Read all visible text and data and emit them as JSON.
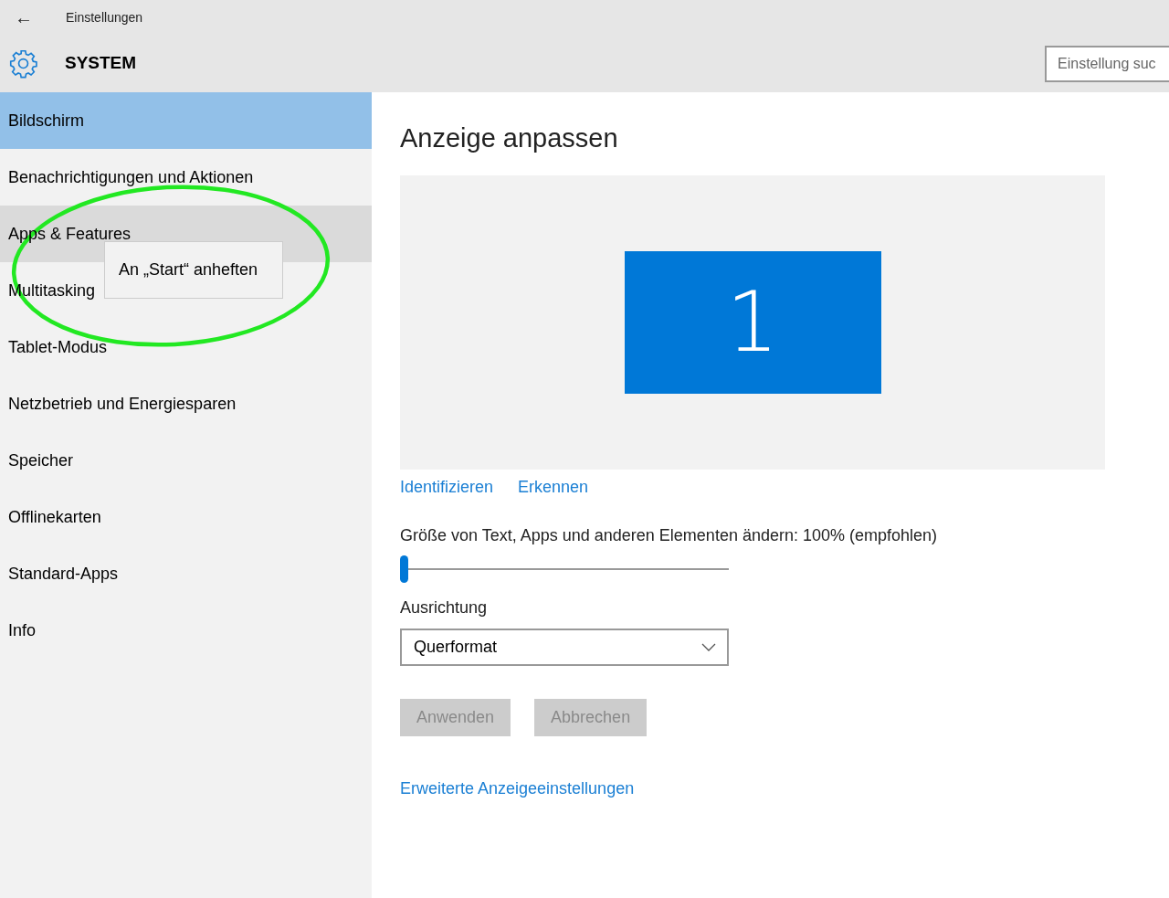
{
  "header": {
    "back_label": "←",
    "app_title": "Einstellungen",
    "section_title": "SYSTEM",
    "search": {
      "placeholder": "Einstellung suc"
    }
  },
  "sidebar": {
    "items": [
      {
        "label": "Bildschirm",
        "selected": true,
        "hovered": false
      },
      {
        "label": "Benachrichtigungen und Aktionen",
        "selected": false,
        "hovered": false
      },
      {
        "label": "Apps & Features",
        "selected": false,
        "hovered": true
      },
      {
        "label": "Multitasking",
        "selected": false,
        "hovered": false
      },
      {
        "label": "Tablet-Modus",
        "selected": false,
        "hovered": false
      },
      {
        "label": "Netzbetrieb und Energiesparen",
        "selected": false,
        "hovered": false
      },
      {
        "label": "Speicher",
        "selected": false,
        "hovered": false
      },
      {
        "label": "Offlinekarten",
        "selected": false,
        "hovered": false
      },
      {
        "label": "Standard-Apps",
        "selected": false,
        "hovered": false
      },
      {
        "label": "Info",
        "selected": false,
        "hovered": false
      }
    ]
  },
  "context_menu": {
    "items": [
      "An „Start“ anheften"
    ]
  },
  "main": {
    "title": "Anzeige anpassen",
    "display_preview": {
      "monitor_number": "1"
    },
    "links": [
      "Identifizieren",
      "Erkennen"
    ],
    "scale": {
      "label": "Größe von Text, Apps und anderen Elementen ändern: 100% (empfohlen)",
      "level": 0
    },
    "orientation": {
      "label": "Ausrichtung",
      "value": "Querformat"
    },
    "buttons": [
      {
        "label": "Anwenden",
        "disabled": true
      },
      {
        "label": "Abbrechen",
        "disabled": true
      }
    ],
    "advanced_link": "Erweiterte Anzeigeeinstellungen"
  }
}
